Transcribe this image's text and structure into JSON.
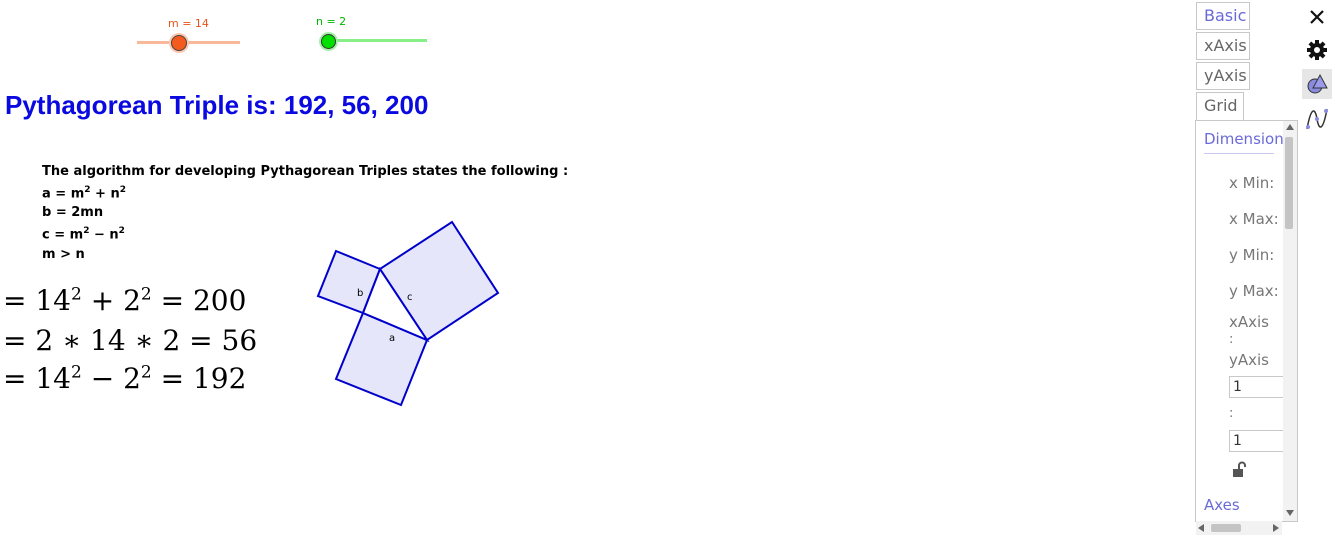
{
  "sliders": {
    "m": {
      "label": "m = 14",
      "value": 14,
      "fraction": 0.42,
      "color": "#f25a1e"
    },
    "n": {
      "label": "n = 2",
      "value": 2,
      "fraction": 0.0,
      "color": "#00d000"
    }
  },
  "title": "Pythagorean Triple is: 192, 56, 200",
  "algorithm": {
    "heading": "The algorithm for developing Pythagorean Triples states the following :",
    "line_a": {
      "lhs": "a = m",
      "mid": " + n",
      "exp": "2"
    },
    "line_b": "b = 2mn",
    "line_c": {
      "lhs": "c = m",
      "mid": " − n",
      "exp": "2"
    },
    "line_m": "m > n"
  },
  "equations": [
    {
      "p1": "= 14",
      "e1": "2",
      "p2": " + 2",
      "e2": "2",
      "p3": " = 200"
    },
    {
      "text": "= 2 ∗ 14 ∗ 2 = 56"
    },
    {
      "p1": "= 14",
      "e1": "2",
      "p2": " − 2",
      "e2": "2",
      "p3": " = 192"
    }
  ],
  "figure": {
    "labels": {
      "a": "a",
      "b": "b",
      "c": "c"
    },
    "stroke": "#0000cc",
    "fill": "#e6e6fa"
  },
  "panel": {
    "tabs": [
      "Basic",
      "xAxis",
      "yAxis",
      "Grid"
    ],
    "section_dimensions": "Dimensions",
    "x_min_label": "x Min:",
    "x_max_label": "x Max:",
    "y_min_label": "y Min:",
    "y_max_label": "y Max:",
    "ratio_label_1": "xAxis",
    "ratio_label_2": ":",
    "ratio_label_3": "yAxis",
    "ratio_x_value": "1",
    "ratio_sep": ":",
    "ratio_y_value": "1",
    "section_axes": "Axes",
    "accent": "#6a6ad8"
  },
  "toolbar_icons": [
    "close-icon",
    "gear-icon",
    "graphics-style-icon",
    "curve-tool-icon"
  ]
}
